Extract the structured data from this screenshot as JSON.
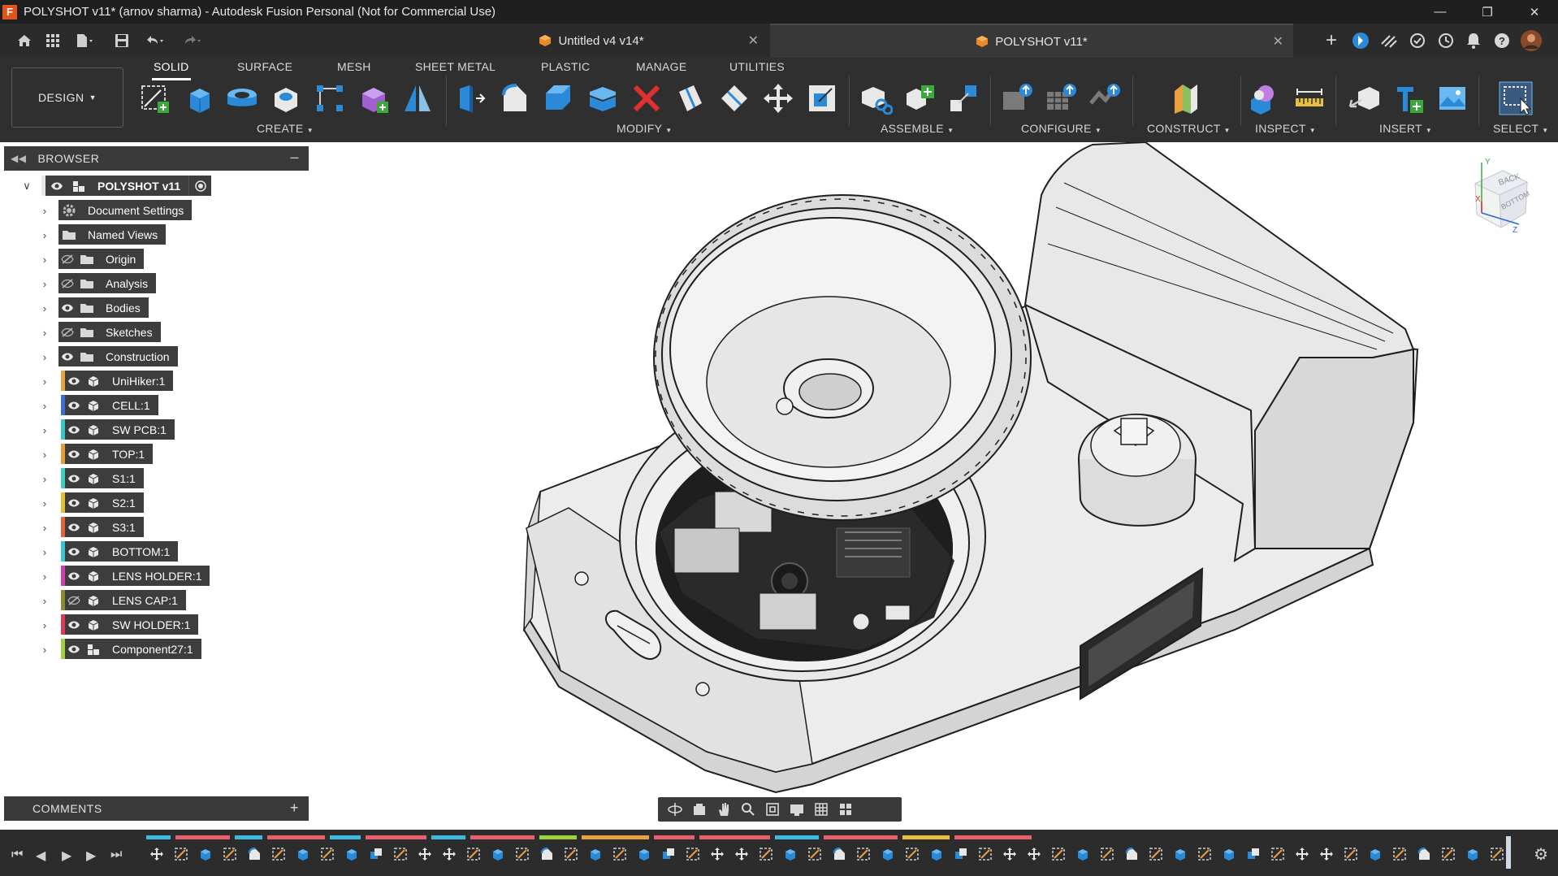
{
  "window": {
    "title": "POLYSHOT v11* (arnov sharma) - Autodesk Fusion Personal (Not for Commercial Use)",
    "app_logo": "F"
  },
  "tabs": [
    {
      "label": "Untitled v4 v14*",
      "active": false
    },
    {
      "label": "POLYSHOT v11*",
      "active": true
    }
  ],
  "toolbar": {
    "workspace_button": "DESIGN",
    "workspace_tabs": [
      "SOLID",
      "SURFACE",
      "MESH",
      "SHEET METAL",
      "PLASTIC",
      "MANAGE",
      "UTILITIES"
    ],
    "active_tab": "SOLID",
    "groups": {
      "create": "CREATE",
      "modify": "MODIFY",
      "assemble": "ASSEMBLE",
      "configure": "CONFIGURE",
      "construct": "CONSTRUCT",
      "inspect": "INSPECT",
      "insert": "INSERT",
      "select": "SELECT"
    }
  },
  "browser": {
    "title": "BROWSER",
    "root": "POLYSHOT v11",
    "items": [
      {
        "label": "Document Settings",
        "icon": "gear-icon",
        "visible": null,
        "color": null
      },
      {
        "label": "Named Views",
        "icon": "folder-icon",
        "visible": null,
        "color": null
      },
      {
        "label": "Origin",
        "icon": "folder-icon",
        "visible": false,
        "color": null
      },
      {
        "label": "Analysis",
        "icon": "folder-icon",
        "visible": false,
        "color": null
      },
      {
        "label": "Bodies",
        "icon": "folder-icon",
        "visible": true,
        "color": null
      },
      {
        "label": "Sketches",
        "icon": "folder-icon",
        "visible": false,
        "color": null
      },
      {
        "label": "Construction",
        "icon": "folder-icon",
        "visible": true,
        "color": null
      },
      {
        "label": "UniHiker:1",
        "icon": "component-icon",
        "visible": true,
        "color": "#e8a040"
      },
      {
        "label": "CELL:1",
        "icon": "component-icon",
        "visible": true,
        "color": "#3a6fd8"
      },
      {
        "label": "SW PCB:1",
        "icon": "component-icon",
        "visible": true,
        "color": "#3ac6c6"
      },
      {
        "label": "TOP:1",
        "icon": "component-icon",
        "visible": true,
        "color": "#e89a3a"
      },
      {
        "label": "S1:1",
        "icon": "component-icon",
        "visible": true,
        "color": "#3ad0c0"
      },
      {
        "label": "S2:1",
        "icon": "component-icon",
        "visible": true,
        "color": "#e0c030"
      },
      {
        "label": "S3:1",
        "icon": "component-icon",
        "visible": true,
        "color": "#e8603a"
      },
      {
        "label": "BOTTOM:1",
        "icon": "component-icon",
        "visible": true,
        "color": "#3ac6d0"
      },
      {
        "label": "LENS HOLDER:1",
        "icon": "component-icon",
        "visible": true,
        "color": "#d040b0"
      },
      {
        "label": "LENS CAP:1",
        "icon": "component-icon",
        "visible": false,
        "color": "#8a8a30"
      },
      {
        "label": "SW HOLDER:1",
        "icon": "component-icon",
        "visible": true,
        "color": "#e03a5a"
      },
      {
        "label": "Component27:1",
        "icon": "assembly-icon",
        "visible": true,
        "color": "#a0d040"
      }
    ]
  },
  "comments": {
    "title": "COMMENTS"
  },
  "viewcube": {
    "faces": [
      "BACK",
      "BOTTOM"
    ],
    "axes": [
      "Y",
      "X",
      "Z"
    ]
  },
  "colors": {
    "accent_blue": "#2a8ad8",
    "toolbar_bg": "#2f2f2f",
    "browser_node_bg": "#3d3d3d",
    "model_body": "#ececec",
    "model_pcb": "#1e1e1e",
    "delete_red": "#e03030"
  }
}
